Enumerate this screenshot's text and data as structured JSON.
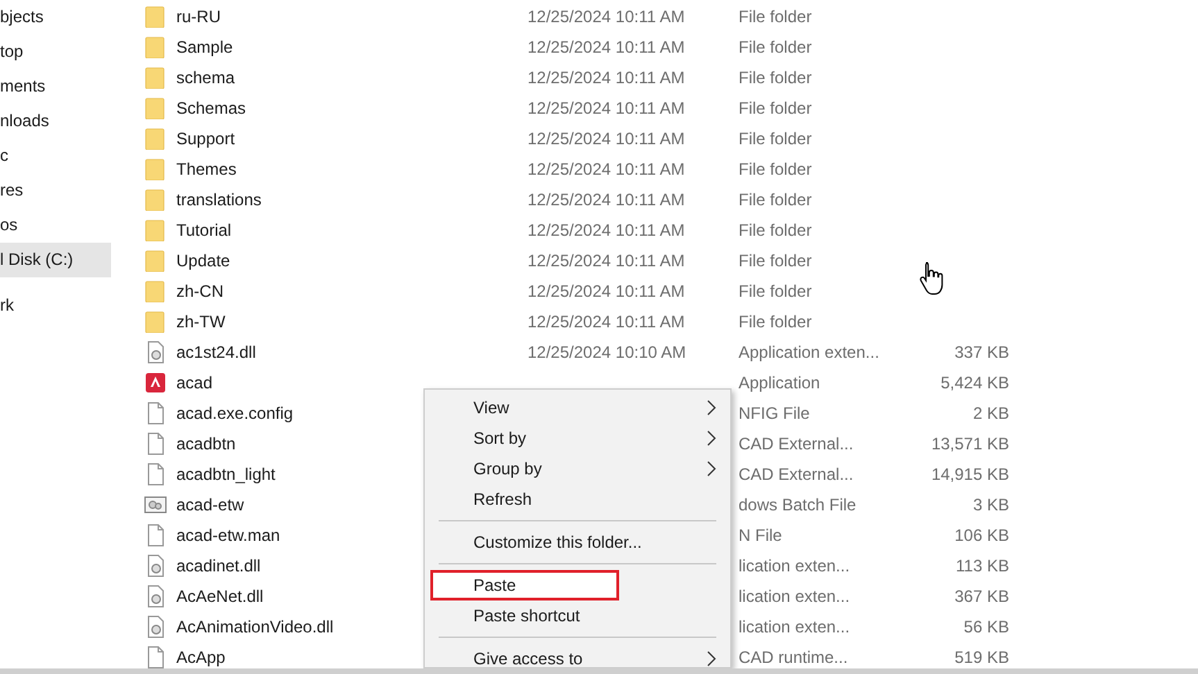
{
  "sidebar": {
    "items": [
      {
        "label": "bjects",
        "selected": false
      },
      {
        "label": "top",
        "selected": false
      },
      {
        "label": "ments",
        "selected": false
      },
      {
        "label": "nloads",
        "selected": false
      },
      {
        "label": "c",
        "selected": false
      },
      {
        "label": "res",
        "selected": false
      },
      {
        "label": "os",
        "selected": false
      },
      {
        "label": "l Disk (C:)",
        "selected": true
      },
      {
        "label": "rk",
        "selected": false,
        "group_start": true
      }
    ]
  },
  "files": [
    {
      "kind": "folder",
      "name": "ru-RU",
      "date": "12/25/2024 10:11 AM",
      "type": "File folder"
    },
    {
      "kind": "folder",
      "name": "Sample",
      "date": "12/25/2024 10:11 AM",
      "type": "File folder"
    },
    {
      "kind": "folder",
      "name": "schema",
      "date": "12/25/2024 10:11 AM",
      "type": "File folder"
    },
    {
      "kind": "folder",
      "name": "Schemas",
      "date": "12/25/2024 10:11 AM",
      "type": "File folder"
    },
    {
      "kind": "folder",
      "name": "Support",
      "date": "12/25/2024 10:11 AM",
      "type": "File folder"
    },
    {
      "kind": "folder",
      "name": "Themes",
      "date": "12/25/2024 10:11 AM",
      "type": "File folder"
    },
    {
      "kind": "folder",
      "name": "translations",
      "date": "12/25/2024 10:11 AM",
      "type": "File folder"
    },
    {
      "kind": "folder",
      "name": "Tutorial",
      "date": "12/25/2024 10:11 AM",
      "type": "File folder"
    },
    {
      "kind": "folder",
      "name": "Update",
      "date": "12/25/2024 10:11 AM",
      "type": "File folder"
    },
    {
      "kind": "folder",
      "name": "zh-CN",
      "date": "12/25/2024 10:11 AM",
      "type": "File folder"
    },
    {
      "kind": "folder",
      "name": "zh-TW",
      "date": "12/25/2024 10:11 AM",
      "type": "File folder"
    },
    {
      "kind": "dll",
      "name": "ac1st24.dll",
      "date": "12/25/2024 10:10 AM",
      "type": "Application exten...",
      "size": "337 KB"
    },
    {
      "kind": "app",
      "name": "acad",
      "type": "Application",
      "size": "5,424 KB"
    },
    {
      "kind": "file",
      "name": "acad.exe.config",
      "type": "NFIG File",
      "size": "2 KB"
    },
    {
      "kind": "file",
      "name": "acadbtn",
      "type": "CAD External...",
      "size": "13,571 KB"
    },
    {
      "kind": "file",
      "name": "acadbtn_light",
      "type": "CAD External...",
      "size": "14,915 KB"
    },
    {
      "kind": "batch",
      "name": "acad-etw",
      "type": "dows Batch File",
      "size": "3 KB"
    },
    {
      "kind": "file",
      "name": "acad-etw.man",
      "type": "N File",
      "size": "106 KB"
    },
    {
      "kind": "dll",
      "name": "acadinet.dll",
      "type": "lication exten...",
      "size": "113 KB"
    },
    {
      "kind": "dll",
      "name": "AcAeNet.dll",
      "type": "lication exten...",
      "size": "367 KB"
    },
    {
      "kind": "dll",
      "name": "AcAnimationVideo.dll",
      "type": "lication exten...",
      "size": "56 KB"
    },
    {
      "kind": "file",
      "name": "AcApp",
      "type": "CAD runtime...",
      "size": "519 KB"
    }
  ],
  "context_menu": {
    "items": [
      {
        "kind": "item",
        "label": "View",
        "submenu": true,
        "highlighted": false
      },
      {
        "kind": "item",
        "label": "Sort by",
        "submenu": true,
        "highlighted": false
      },
      {
        "kind": "item",
        "label": "Group by",
        "submenu": true,
        "highlighted": false
      },
      {
        "kind": "item",
        "label": "Refresh",
        "submenu": false,
        "highlighted": false
      },
      {
        "kind": "separator"
      },
      {
        "kind": "item",
        "label": "Customize this folder...",
        "submenu": false,
        "highlighted": false
      },
      {
        "kind": "separator"
      },
      {
        "kind": "item",
        "label": "Paste",
        "submenu": false,
        "highlighted": true
      },
      {
        "kind": "item",
        "label": "Paste shortcut",
        "submenu": false,
        "highlighted": false
      },
      {
        "kind": "separator"
      },
      {
        "kind": "item",
        "label": "Give access to",
        "submenu": true,
        "highlighted": false
      }
    ]
  }
}
